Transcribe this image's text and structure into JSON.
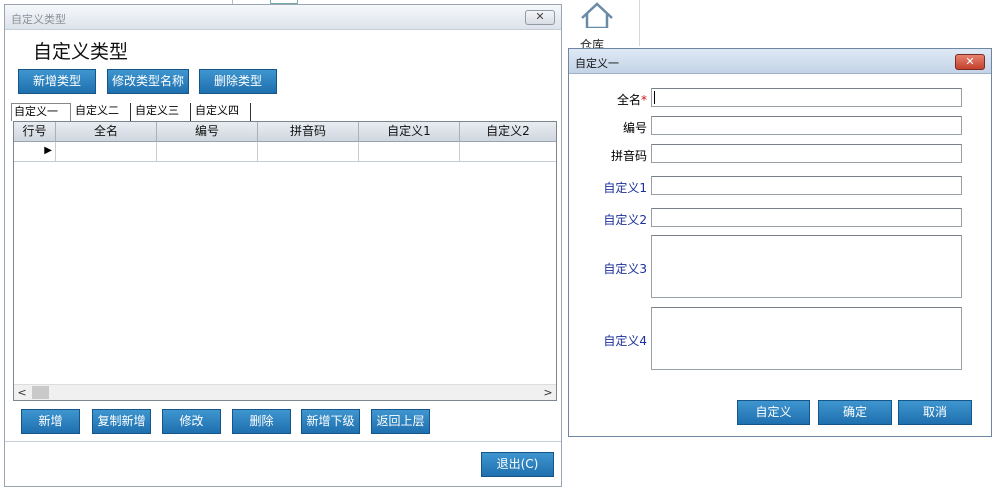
{
  "background": {
    "app_label": "仓库"
  },
  "left_window": {
    "title": "自定义类型",
    "close_label": "✕",
    "heading": "自定义类型",
    "top_buttons": {
      "add_type": "新增类型",
      "rename_type": "修改类型名称",
      "delete_type": "删除类型"
    },
    "tabs": [
      "自定义一",
      "自定义二",
      "自定义三",
      "自定义四"
    ],
    "grid": {
      "columns": [
        "行号",
        "全名",
        "编号",
        "拼音码",
        "自定义1",
        "自定义2"
      ],
      "rows": [
        {
          "indicator": "▶",
          "cells": [
            "",
            "",
            "",
            "",
            ""
          ]
        }
      ],
      "scroll_left": "<",
      "scroll_right": ">"
    },
    "bottom_buttons": {
      "add": "新增",
      "copy_add": "复制新增",
      "edit": "修改",
      "delete": "删除",
      "add_child": "新增下级",
      "back_up": "返回上层"
    },
    "exit_button": "退出(C)"
  },
  "right_window": {
    "title": "自定义一",
    "close_label": "✕",
    "fields": {
      "full_name_label": "全名",
      "required_mark": "*",
      "code_label": "编号",
      "pinyin_label": "拼音码",
      "custom1_label": "自定义1",
      "custom2_label": "自定义2",
      "custom3_label": "自定义3",
      "custom4_label": "自定义4"
    },
    "buttons": {
      "custom": "自定义",
      "ok": "确定",
      "cancel": "取消"
    }
  },
  "colors": {
    "button_blue": "#2a7fbf",
    "label_blue": "#1b2f9a",
    "required_red": "#d01010"
  }
}
